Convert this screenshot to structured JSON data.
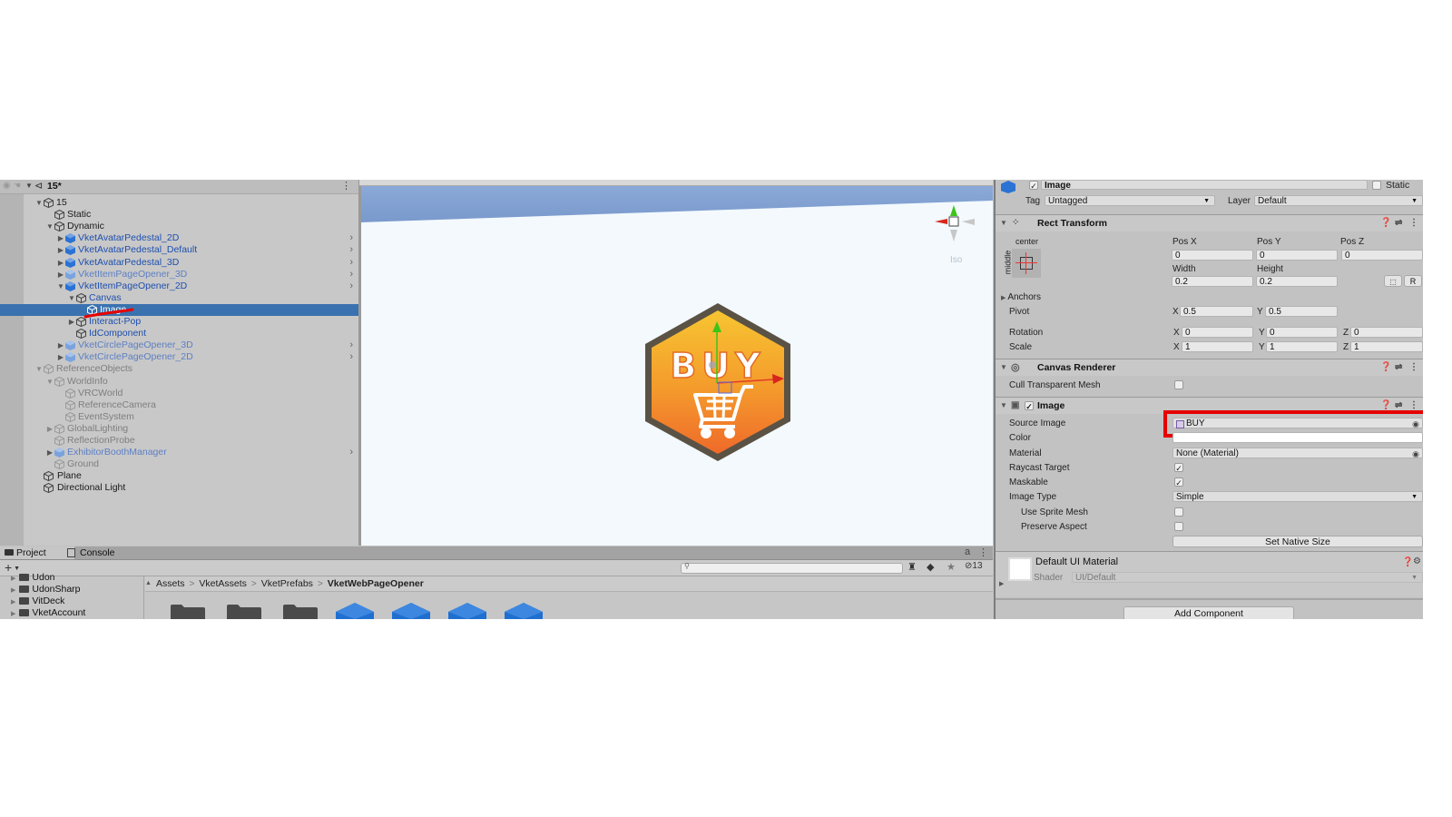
{
  "hierarchy": {
    "scene_name": "15*",
    "items": [
      {
        "label": "15",
        "color": "black",
        "indent": 0,
        "arrow": "down",
        "icon": "gameobject"
      },
      {
        "label": "Static",
        "color": "black",
        "indent": 1,
        "arrow": "",
        "icon": "gameobject"
      },
      {
        "label": "Dynamic",
        "color": "black",
        "indent": 1,
        "arrow": "down",
        "icon": "gameobject"
      },
      {
        "label": "VketAvatarPedestal_2D",
        "color": "blue",
        "indent": 2,
        "arrow": "right",
        "icon": "prefab",
        "chevron": true
      },
      {
        "label": "VketAvatarPedestal_Default",
        "color": "blue",
        "indent": 2,
        "arrow": "right",
        "icon": "prefab",
        "chevron": true
      },
      {
        "label": "VketAvatarPedestal_3D",
        "color": "blue",
        "indent": 2,
        "arrow": "right",
        "icon": "prefab",
        "chevron": true
      },
      {
        "label": "VketItemPageOpener_3D",
        "color": "lblue",
        "indent": 2,
        "arrow": "right",
        "icon": "prefab-light",
        "chevron": true
      },
      {
        "label": "VketItemPageOpener_2D",
        "color": "blue",
        "indent": 2,
        "arrow": "down",
        "icon": "prefab",
        "chevron": true
      },
      {
        "label": "Canvas",
        "color": "blue",
        "indent": 3,
        "arrow": "down",
        "icon": "gameobject"
      },
      {
        "label": "Image",
        "color": "blue",
        "indent": 4,
        "arrow": "",
        "icon": "gameobject",
        "selected": true
      },
      {
        "label": "Interact-Pop",
        "color": "blue",
        "indent": 3,
        "arrow": "right",
        "icon": "gameobject"
      },
      {
        "label": "IdComponent",
        "color": "blue",
        "indent": 3,
        "arrow": "",
        "icon": "gameobject"
      },
      {
        "label": "VketCirclePageOpener_3D",
        "color": "lblue",
        "indent": 2,
        "arrow": "right",
        "icon": "prefab-light",
        "chevron": true
      },
      {
        "label": "VketCirclePageOpener_2D",
        "color": "lblue",
        "indent": 2,
        "arrow": "right",
        "icon": "prefab-light",
        "chevron": true
      },
      {
        "label": "ReferenceObjects",
        "color": "gray",
        "indent": 0,
        "arrow": "down",
        "icon": "gameobject-gray"
      },
      {
        "label": "WorldInfo",
        "color": "gray",
        "indent": 1,
        "arrow": "down",
        "icon": "gameobject-gray"
      },
      {
        "label": "VRCWorld",
        "color": "gray",
        "indent": 2,
        "arrow": "",
        "icon": "gameobject-gray"
      },
      {
        "label": "ReferenceCamera",
        "color": "gray",
        "indent": 2,
        "arrow": "",
        "icon": "gameobject-gray"
      },
      {
        "label": "EventSystem",
        "color": "gray",
        "indent": 2,
        "arrow": "",
        "icon": "gameobject-gray"
      },
      {
        "label": "GlobalLighting",
        "color": "gray",
        "indent": 1,
        "arrow": "right",
        "icon": "gameobject-gray"
      },
      {
        "label": "ReflectionProbe",
        "color": "gray",
        "indent": 1,
        "arrow": "",
        "icon": "gameobject-gray"
      },
      {
        "label": "ExhibitorBoothManager",
        "color": "lblue",
        "indent": 1,
        "arrow": "right",
        "icon": "prefab-light",
        "chevron": true
      },
      {
        "label": "Ground",
        "color": "gray",
        "indent": 1,
        "arrow": "",
        "icon": "gameobject-gray"
      },
      {
        "label": "Plane",
        "color": "black",
        "indent": 0,
        "arrow": "",
        "icon": "gameobject",
        "root": true
      },
      {
        "label": "Directional Light",
        "color": "black",
        "indent": 0,
        "arrow": "",
        "icon": "gameobject",
        "root": true
      }
    ]
  },
  "scene": {
    "projection_label": "Iso",
    "sprite_text": "BUY",
    "colors": {
      "badge_top": "#f7c531",
      "badge_bottom": "#ef6a2a",
      "badge_border": "#5a5244",
      "gizmo_x": "#d8261c",
      "gizmo_y": "#3dc41a"
    }
  },
  "project": {
    "tabs": [
      {
        "label": "Project",
        "icon": "folder-icon",
        "active": true
      },
      {
        "label": "Console",
        "icon": "console-icon",
        "active": false
      }
    ],
    "add_label": "+",
    "hidden_count": "13",
    "tree": [
      "Udon",
      "UdonSharp",
      "VitDeck",
      "VketAccount"
    ],
    "breadcrumb": [
      "Assets",
      "VketAssets",
      "VketPrefabs",
      "VketWebPageOpener"
    ],
    "assets": [
      {
        "type": "folder"
      },
      {
        "type": "folder"
      },
      {
        "type": "folder"
      },
      {
        "type": "prefab"
      },
      {
        "type": "prefab"
      },
      {
        "type": "prefab"
      },
      {
        "type": "prefab"
      }
    ]
  },
  "inspector": {
    "object_name": "Image",
    "active": true,
    "static_label": "Static",
    "tag_label": "Tag",
    "tag_value": "Untagged",
    "layer_label": "Layer",
    "layer_value": "Default",
    "rect_transform": {
      "title": "Rect Transform",
      "anchor_h": "center",
      "anchor_v": "middle",
      "pos_x_label": "Pos X",
      "pos_x": "0",
      "pos_y_label": "Pos Y",
      "pos_y": "0",
      "pos_z_label": "Pos Z",
      "pos_z": "0",
      "width_label": "Width",
      "width": "0.2",
      "height_label": "Height",
      "height": "0.2",
      "r_button": "R",
      "anchors_label": "Anchors",
      "pivot_label": "Pivot",
      "pivot_x": "0.5",
      "pivot_y": "0.5",
      "rotation_label": "Rotation",
      "rot_x": "0",
      "rot_y": "0",
      "rot_z": "0",
      "scale_label": "Scale",
      "scale_x": "1",
      "scale_y": "1",
      "scale_z": "1",
      "x": "X",
      "y": "Y",
      "z": "Z"
    },
    "canvas_renderer": {
      "title": "Canvas Renderer",
      "cull_label": "Cull Transparent Mesh",
      "cull_value": false
    },
    "image": {
      "title": "Image",
      "enabled": true,
      "source_label": "Source Image",
      "source_value": "BUY",
      "color_label": "Color",
      "color_value": "#ffffff",
      "material_label": "Material",
      "material_value": "None (Material)",
      "raycast_label": "Raycast Target",
      "raycast_value": true,
      "maskable_label": "Maskable",
      "maskable_value": true,
      "type_label": "Image Type",
      "type_value": "Simple",
      "sprite_mesh_label": "Use Sprite Mesh",
      "sprite_mesh_value": false,
      "preserve_label": "Preserve Aspect",
      "preserve_value": false,
      "native_size_button": "Set Native Size"
    },
    "material": {
      "name": "Default UI Material",
      "shader_label": "Shader",
      "shader_value": "UI/Default"
    },
    "add_component": "Add Component"
  },
  "annotation": {
    "highlight_color": "#e60000"
  }
}
